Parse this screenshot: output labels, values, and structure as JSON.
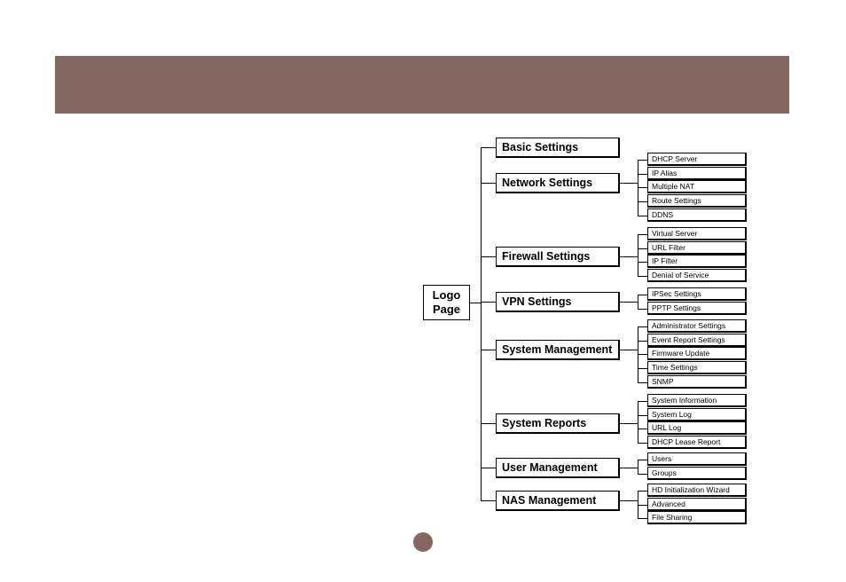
{
  "theme": {
    "accent": "#856862",
    "line": "#000000",
    "box_bg": "#ffffff"
  },
  "diagram": {
    "root": {
      "label": "Logo\nPage"
    },
    "branches": [
      {
        "label": "Basic Settings",
        "children": []
      },
      {
        "label": "Network Settings",
        "children": [
          "DHCP Server",
          "IP Alias",
          "Multiple NAT",
          "Route Settings",
          "DDNS"
        ]
      },
      {
        "label": "Firewall Settings",
        "children": [
          "Virtual Server",
          "URL Filter",
          "IP Filter",
          "Denial of Service"
        ]
      },
      {
        "label": "VPN Settings",
        "children": [
          "IPSec Settings",
          "PPTP Settings"
        ]
      },
      {
        "label": "System Management",
        "children": [
          "Administrator Settings",
          "Event Report Settings",
          "Firmware Update",
          "Time Settings",
          "SNMP"
        ]
      },
      {
        "label": "System Reports",
        "children": [
          "System Information",
          "System Log",
          "URL Log",
          "DHCP Lease Report"
        ]
      },
      {
        "label": "User Management",
        "children": [
          "Users",
          "Groups"
        ]
      },
      {
        "label": "NAS Management",
        "children": [
          "HD Initialization Wizard",
          "Advanced",
          "File Sharing"
        ]
      }
    ]
  }
}
